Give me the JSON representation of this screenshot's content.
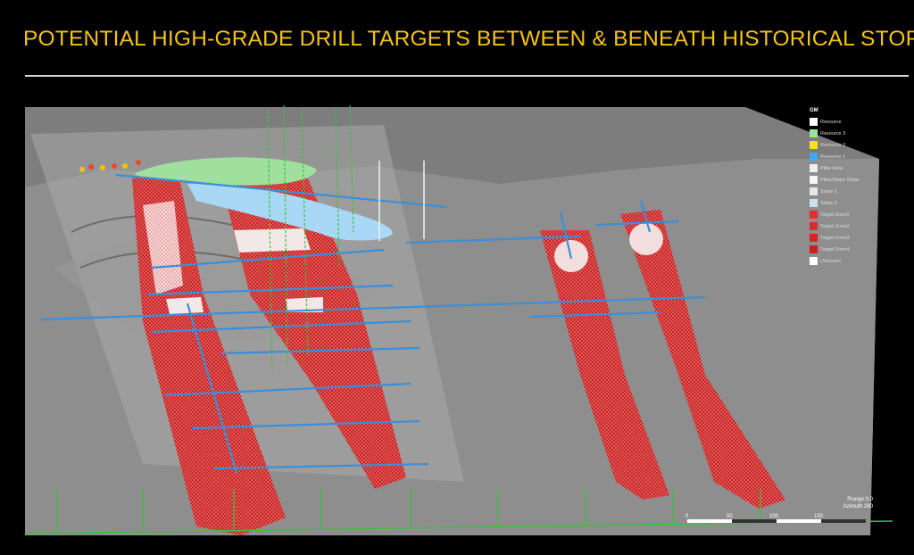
{
  "header": {
    "title": "POTENTIAL HIGH-GRADE DRILL TARGETS BETWEEN & BENEATH HISTORICAL STOPES"
  },
  "colors": {
    "title": "#f2c21a",
    "background": "#000000",
    "target_zone": "#d42222",
    "drill_trace": "#3b8fd8",
    "grid_line": "#39c439"
  },
  "legend": {
    "heading": "GM",
    "items": [
      {
        "label": "Resource",
        "color": "#ffffff"
      },
      {
        "label": "Resource 3",
        "color": "#9be39b"
      },
      {
        "label": "Resource 2",
        "color": "#f4e21c"
      },
      {
        "label": "Resource 1",
        "color": "#3fa9f5"
      },
      {
        "label": "Pillar Area",
        "color": "#eeeeee"
      },
      {
        "label": "Pillar/Stope Stope",
        "color": "#f5f5f5"
      },
      {
        "label": "Stope 1",
        "color": "#e6e6e6"
      },
      {
        "label": "Stope 2",
        "color": "#c9e3f2"
      },
      {
        "label": "Target Zone1",
        "color": "#e03030"
      },
      {
        "label": "Target Zone2",
        "color": "#e02a2a"
      },
      {
        "label": "Target Zone3",
        "color": "#d82424"
      },
      {
        "label": "Target Zone4",
        "color": "#d01e1e"
      },
      {
        "label": "Unknown",
        "color": "#ffffff"
      }
    ]
  },
  "scale": {
    "plunge": "Plunge 0.0",
    "azimuth": "Azimuth 280",
    "ticks": [
      "0",
      "50",
      "100",
      "150"
    ]
  }
}
